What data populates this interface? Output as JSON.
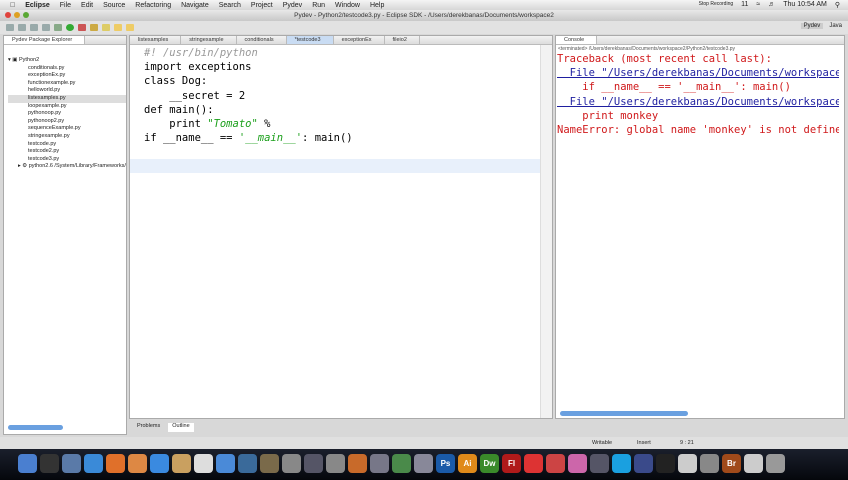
{
  "menubar": {
    "app": "Eclipse",
    "items": [
      "File",
      "Edit",
      "Source",
      "Refactoring",
      "Navigate",
      "Search",
      "Project",
      "Pydev",
      "Run",
      "Window",
      "Help"
    ],
    "recording": "Stop Recording",
    "clock": "Thu 10:54 AM",
    "icon_label": "11"
  },
  "window": {
    "title": "Pydev - Python2/testcode3.py - Eclipse SDK - /Users/derekbanas/Documents/workspace2"
  },
  "perspectives": [
    "Pydev",
    "Java"
  ],
  "explorer": {
    "title": "Pydev Package Explorer",
    "project": "Python2",
    "files": [
      "conditionals.py",
      "exceptionEx.py",
      "functionexample.py",
      "helloworld.py",
      "listexamples.py",
      "loopexample.py",
      "pythonoop.py",
      "pythonoop2.py",
      "sequenceExample.py",
      "stringexample.py",
      "testcode.py",
      "testcode2.py",
      "testcode3.py"
    ],
    "selected": "listexamples.py",
    "interpreter": "python2.6  /System/Library/Frameworks/"
  },
  "editor": {
    "tabs": [
      "listexamples",
      "stringexample",
      "conditionals",
      "*testcode3",
      "exceptionEx",
      "fileio2"
    ],
    "active_tab": "*testcode3",
    "lines": [
      "#! /usr/bin/python",
      "import exceptions",
      "",
      "class Dog:",
      "    __secret = 2",
      "",
      "",
      "def main():",
      "    print \"Tomato\" %",
      "",
      "",
      "",
      "if __name__ == '__main__': main()"
    ]
  },
  "console": {
    "title": "Console",
    "terminated": "<terminated> /Users/derekbanas/Documents/workspace2/Python2/testcode3.py",
    "lines": [
      "Traceback (most recent call last):",
      "  File \"/Users/derekbanas/Documents/workspace2/Python2/testcode3.py\"",
      "    if __name__ == '__main__': main()",
      "  File \"/Users/derekbanas/Documents/workspace2/Python2/testcode3.py\"",
      "    print monkey",
      "NameError: global name 'monkey' is not defined"
    ]
  },
  "bottom_tabs": [
    "Problems",
    "Outline"
  ],
  "status": {
    "writable": "Writable",
    "mode": "Insert",
    "position": "9 : 21"
  },
  "dock_apps": [
    "Finder",
    "Dashboard",
    "Preview",
    "Safari",
    "Firefox",
    "Chrome",
    "iChat",
    "Address Book",
    "iCal",
    "iTunes",
    "Time Machine",
    "iPhoto",
    "Xcode",
    "Spaces",
    "System Preferences",
    "Keynote",
    "Script Editor",
    "Numbers",
    "TextEdit",
    "Ps",
    "Ai",
    "Dw",
    "Fl",
    "Acrobat",
    "TextMate",
    "Flower",
    "Final Cut",
    "Skype",
    "Eclipse",
    "Terminal",
    "Calculator",
    "Camera",
    "Br",
    "Pages",
    "Trash"
  ]
}
